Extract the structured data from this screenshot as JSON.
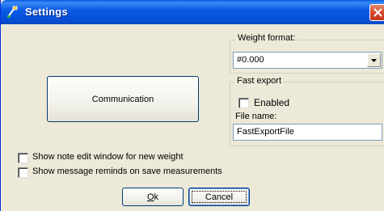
{
  "window": {
    "title": "Settings",
    "icon": "scale-app-icon",
    "close_icon": "close-icon"
  },
  "main": {
    "communication_button": "Communication",
    "ok_button": {
      "mnemonic": "O",
      "rest": "k"
    },
    "cancel_button": "Cancel"
  },
  "weight_format": {
    "label": "Weight format:",
    "selected_value": "#0.000"
  },
  "fast_export": {
    "label": "Fast export",
    "enabled_label": "Enabled",
    "enabled_checked": false,
    "file_name_label": "File name:",
    "file_name_value": "FastExportFile"
  },
  "options": {
    "show_note_label": "Show note edit window for new weight",
    "show_note_checked": false,
    "show_message_label": "Show message reminds on save measurements",
    "show_message_checked": false
  },
  "colors": {
    "titlebar": "#0b5ce6",
    "dialog_bg": "#ece9d8",
    "close_red": "#d8482a",
    "button_border": "#003c74"
  }
}
